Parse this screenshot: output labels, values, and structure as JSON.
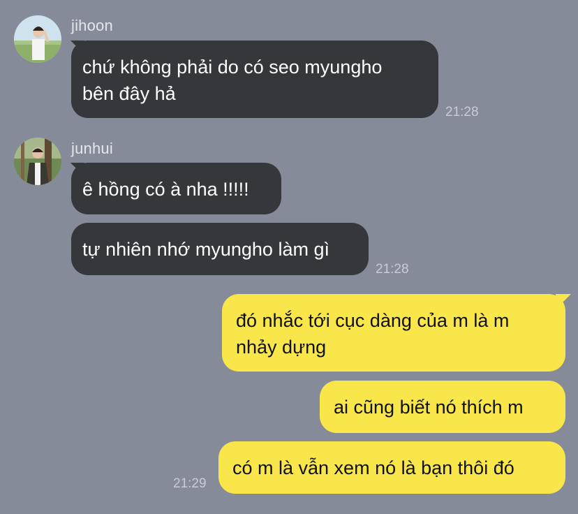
{
  "messages": [
    {
      "sender": "jihoon",
      "text": "chứ không phải do có seo myungho\nbên đây hả",
      "time": "21:28"
    },
    {
      "sender": "junhui",
      "text1": "ê hồng có à nha !!!!!",
      "text2": "tự nhiên nhớ myungho làm gì",
      "time": "21:28"
    },
    {
      "out1": "đó nhắc tới cục dàng của m là m\nnhảy dựng",
      "out2": "ai cũng biết nó thích m",
      "out3": "có m là vẫn xem nó là bạn thôi đó",
      "time": "21:29"
    }
  ],
  "colors": {
    "background": "#858b99",
    "incoming": "#35373d",
    "outgoing": "#f9e64b"
  }
}
